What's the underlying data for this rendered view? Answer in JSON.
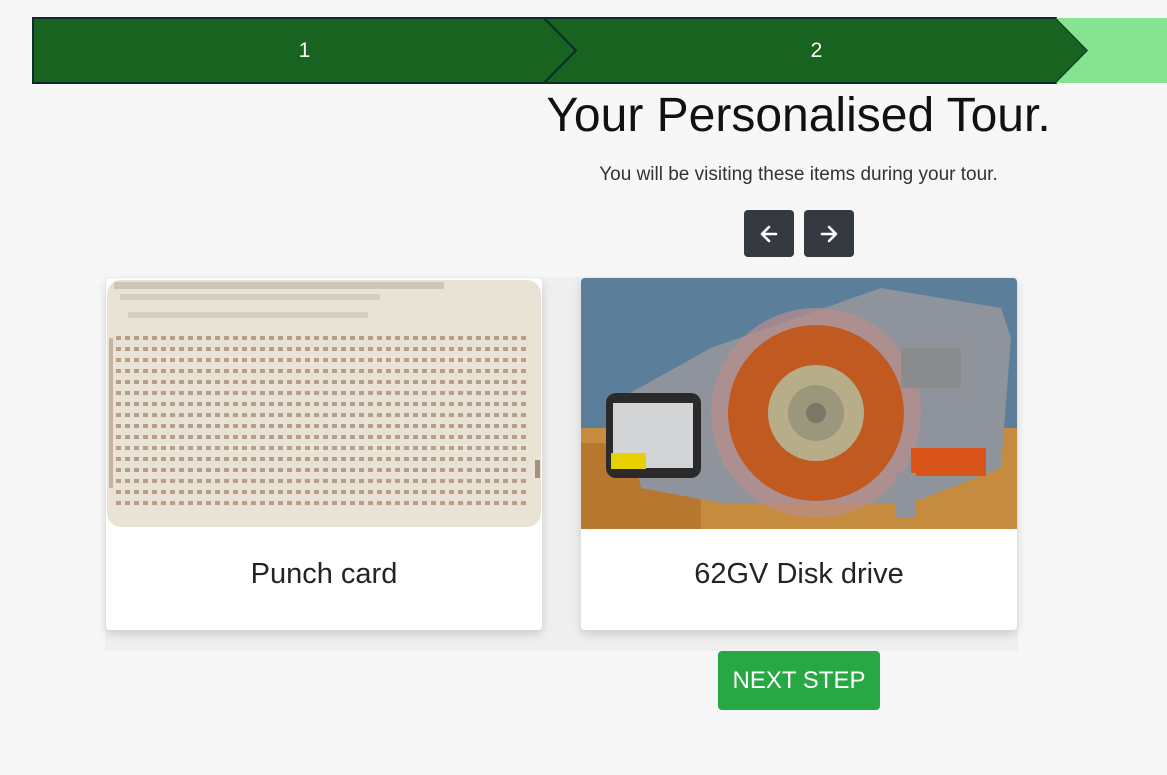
{
  "progress": {
    "steps": [
      {
        "label": "1",
        "color": "#17631f"
      },
      {
        "label": "2",
        "color": "#17631f"
      },
      {
        "label": "",
        "color": "#86e38f"
      }
    ]
  },
  "header": {
    "title": "Your Personalised Tour.",
    "subtitle": "You will be visiting these items during your tour."
  },
  "carousel": {
    "prev_icon": "arrow-left-icon",
    "next_icon": "arrow-right-icon",
    "items": [
      {
        "title": "Punch card",
        "image": "punch-card-photo"
      },
      {
        "title": "62GV Disk drive",
        "image": "disk-drive-photo"
      }
    ]
  },
  "actions": {
    "next_step_label": "NEXT STEP"
  },
  "colors": {
    "step_active": "#17631f",
    "step_pending": "#86e38f",
    "nav_button": "#343a40",
    "primary_action": "#28a745"
  }
}
